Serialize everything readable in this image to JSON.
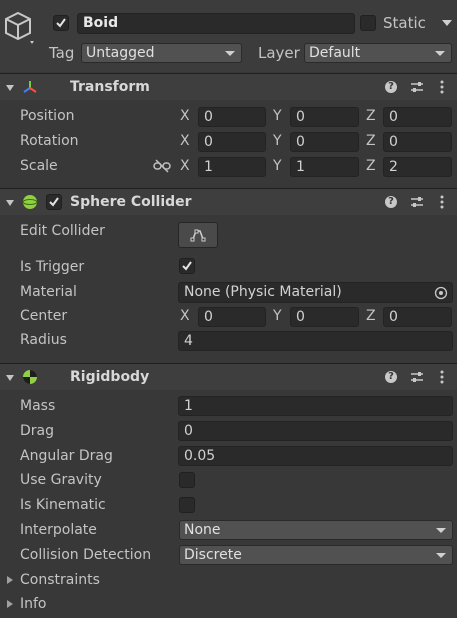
{
  "object": {
    "active": true,
    "name": "Boid",
    "static_label": "Static",
    "tag_label": "Tag",
    "tag_value": "Untagged",
    "layer_label": "Layer",
    "layer_value": "Default"
  },
  "transform": {
    "title": "Transform",
    "position": {
      "label": "Position",
      "x": "0",
      "y": "0",
      "z": "0"
    },
    "rotation": {
      "label": "Rotation",
      "x": "0",
      "y": "0",
      "z": "0"
    },
    "scale": {
      "label": "Scale",
      "x": "1",
      "y": "1",
      "z": "2"
    }
  },
  "axes": {
    "x": "X",
    "y": "Y",
    "z": "Z"
  },
  "sphere_collider": {
    "title": "Sphere Collider",
    "enabled": true,
    "edit_collider_label": "Edit Collider",
    "is_trigger_label": "Is Trigger",
    "is_trigger": true,
    "material_label": "Material",
    "material_value": "None (Physic Material)",
    "center": {
      "label": "Center",
      "x": "0",
      "y": "0",
      "z": "0"
    },
    "radius_label": "Radius",
    "radius_value": "4"
  },
  "rigidbody": {
    "title": "Rigidbody",
    "mass_label": "Mass",
    "mass_value": "1",
    "drag_label": "Drag",
    "drag_value": "0",
    "angular_drag_label": "Angular Drag",
    "angular_drag_value": "0.05",
    "use_gravity_label": "Use Gravity",
    "use_gravity": false,
    "is_kinematic_label": "Is Kinematic",
    "is_kinematic": false,
    "interpolate_label": "Interpolate",
    "interpolate_value": "None",
    "collision_detection_label": "Collision Detection",
    "collision_detection_value": "Discrete",
    "constraints_label": "Constraints",
    "info_label": "Info"
  },
  "colors": {
    "background": "#383838",
    "field": "#2a2a2a",
    "header": "#3e3e3e",
    "dropdown": "#515151"
  },
  "icons": {
    "object": "cube-icon",
    "transform": "transform-axes-icon",
    "sphere_collider": "sphere-collider-icon",
    "rigidbody": "rigidbody-icon",
    "help": "help-icon",
    "presets": "presets-icon",
    "context_menu": "kebab-menu-icon",
    "constrain_scale": "unlinked-chain-icon",
    "edit_collider": "edit-collider-icon",
    "object_picker": "object-picker-icon"
  }
}
